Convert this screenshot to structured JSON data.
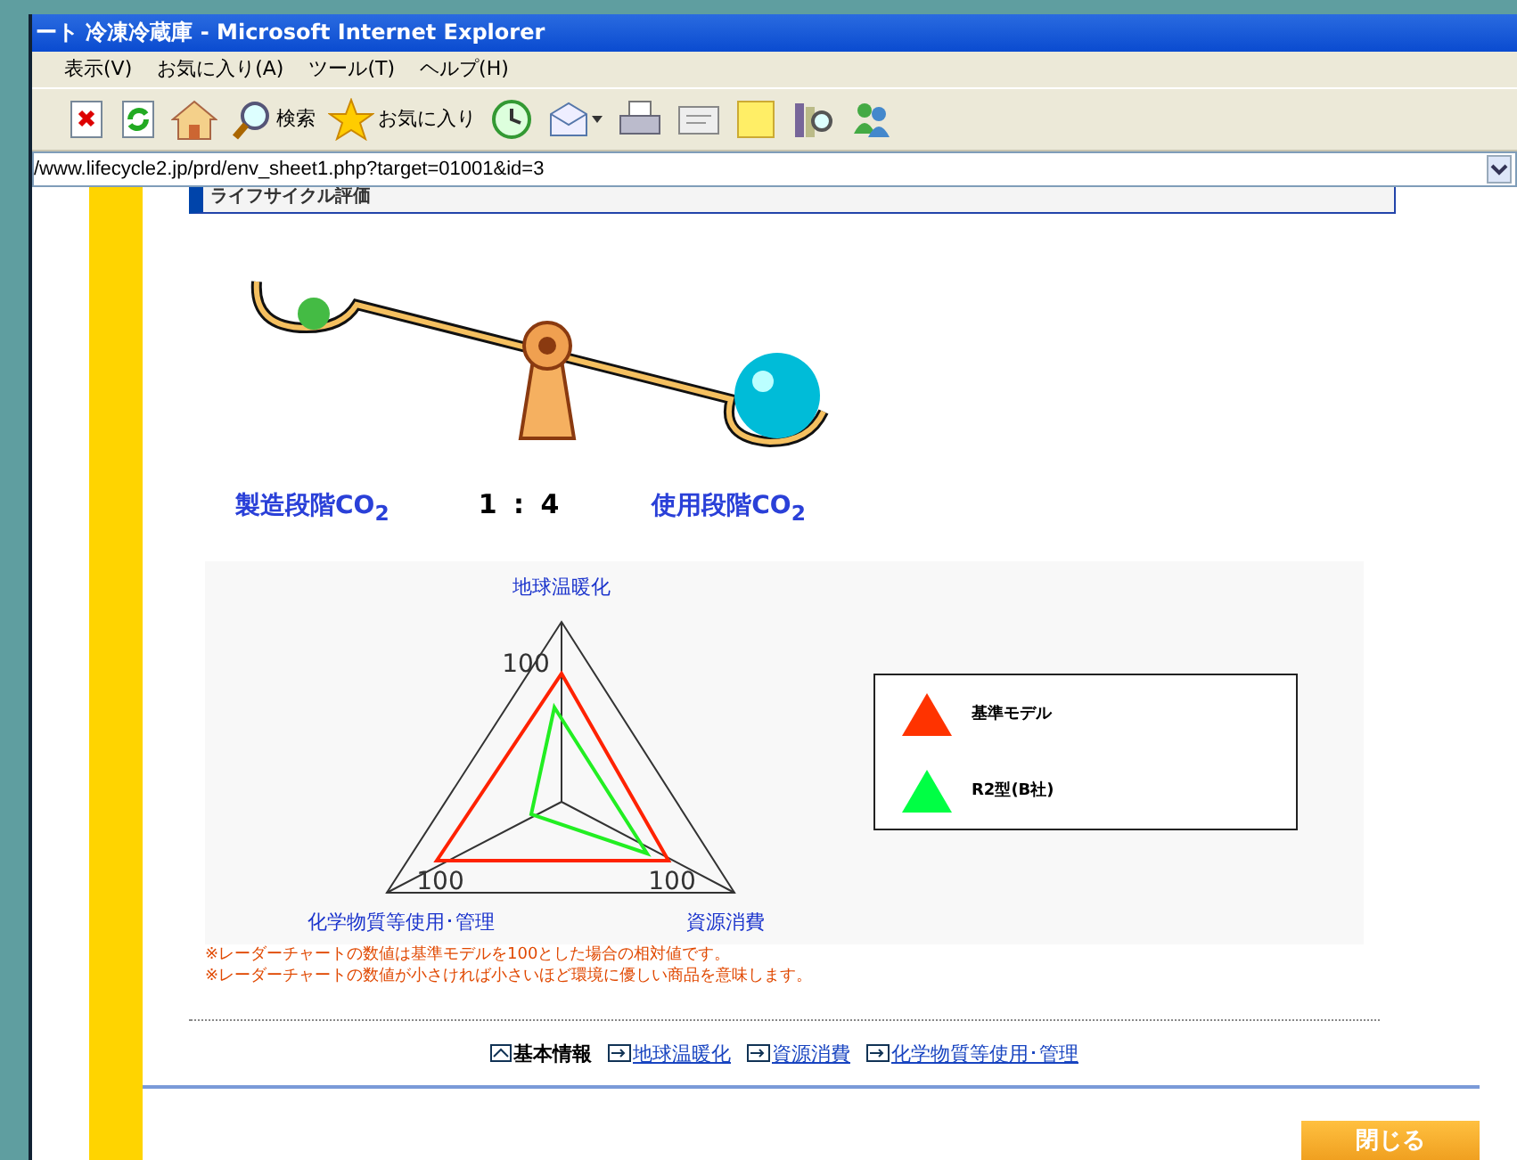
{
  "window": {
    "title": "ート 冷凍冷蔵庫 - Microsoft Internet Explorer"
  },
  "menu": [
    "表示(V)",
    "お気に入り(A)",
    "ツール(T)",
    "ヘルプ(H)"
  ],
  "toolbar": [
    {
      "kind": "icon"
    },
    {
      "kind": "icon"
    },
    {
      "kind": "icon"
    },
    {
      "kind": "labeled",
      "label": "検索"
    },
    {
      "kind": "labeled",
      "label": "お気に入り"
    },
    {
      "kind": "icon"
    },
    {
      "kind": "icon"
    },
    {
      "kind": "icon"
    },
    {
      "kind": "icon"
    },
    {
      "kind": "icon"
    },
    {
      "kind": "icon"
    },
    {
      "kind": "icon"
    }
  ],
  "address": "/www.lifecycle2.jp/prd/env_sheet1.php?target=01001&id=3",
  "section_title": "ライフサイクル評価",
  "seesaw": {
    "left_label": "製造段階CO$_{2}$",
    "ratio": "1 : 4",
    "right_label": "使用段階CO$_{2}$"
  },
  "radar": {
    "axes": [
      "地球温暖化",
      "資源消費",
      "化学物質等使用･管理"
    ],
    "scale_labels": [
      "100",
      "100",
      "100"
    ],
    "legend": [
      {
        "label": "基準モデル",
        "color": "#ff3300"
      },
      {
        "label": "R2型(B社)",
        "color": "#00ff44"
      }
    ]
  },
  "notes": [
    "※レーダーチャートの数値は基準モデルを100とした場合の相対値です。",
    "※レーダーチャートの数値が小さければ小さいほど環境に優しい商品を意味します。"
  ],
  "nav": [
    {
      "label": "基本情報",
      "current": true
    },
    {
      "label": "地球温暖化",
      "current": false
    },
    {
      "label": "資源消費",
      "current": false
    },
    {
      "label": "化学物質等使用･管理",
      "current": false
    }
  ],
  "close_button": "閉じる"
}
